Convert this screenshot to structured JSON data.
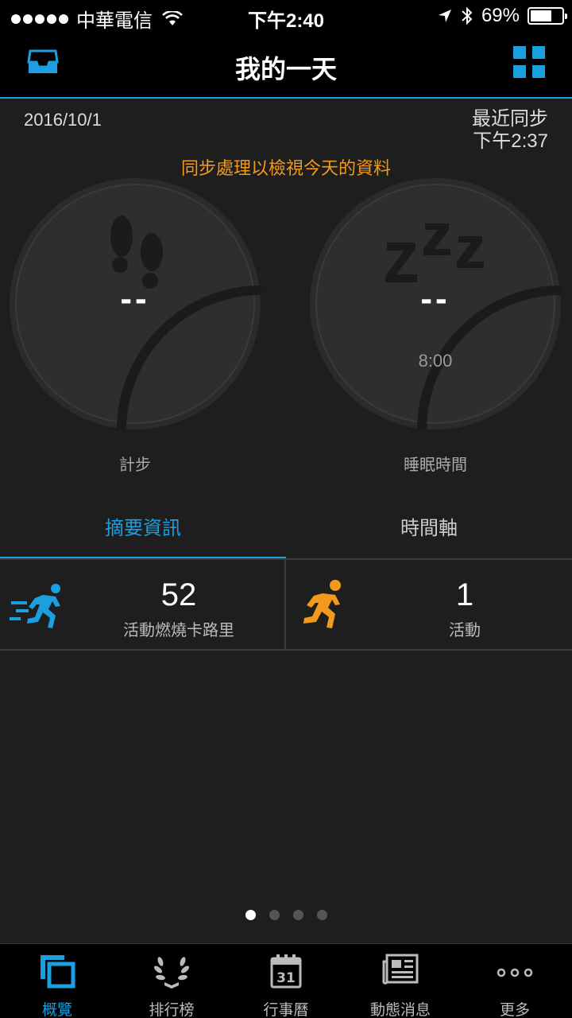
{
  "status_bar": {
    "carrier": "中華電信",
    "time": "下午2:40",
    "battery": "69%",
    "battery_level": 0.69
  },
  "header": {
    "title": "我的一天"
  },
  "info": {
    "date": "2016/10/1",
    "sync_label": "最近同步",
    "sync_time": "下午2:37",
    "sync_message": "同步處理以檢視今天的資料"
  },
  "gauges": {
    "steps": {
      "value": "--",
      "label": "計步",
      "icon": "footprints-icon"
    },
    "sleep": {
      "value": "--",
      "goal": "8:00",
      "label": "睡眠時間",
      "icon": "sleep-zzz-icon"
    }
  },
  "tabs": [
    {
      "label": "摘要資訊",
      "active": true
    },
    {
      "label": "時間軸",
      "active": false
    }
  ],
  "stats": [
    {
      "value": "52",
      "label": "活動燃燒卡路里",
      "icon": "running-fast-icon",
      "color": "#1a9fe0"
    },
    {
      "value": "1",
      "label": "活動",
      "icon": "running-icon",
      "color": "#f29a1c"
    }
  ],
  "page_indicator": {
    "count": 4,
    "current": 1
  },
  "bottom_nav": [
    {
      "label": "概覽",
      "icon": "overview-icon",
      "active": true
    },
    {
      "label": "排行榜",
      "icon": "laurel-icon",
      "active": false
    },
    {
      "label": "行事曆",
      "icon": "calendar-icon",
      "calendar_day": "31",
      "active": false
    },
    {
      "label": "動態消息",
      "icon": "newspaper-icon",
      "active": false
    },
    {
      "label": "更多",
      "icon": "more-icon",
      "active": false
    }
  ],
  "colors": {
    "accent": "#1a9fe0",
    "warning": "#f29a1c",
    "background": "#1e1e1e"
  }
}
